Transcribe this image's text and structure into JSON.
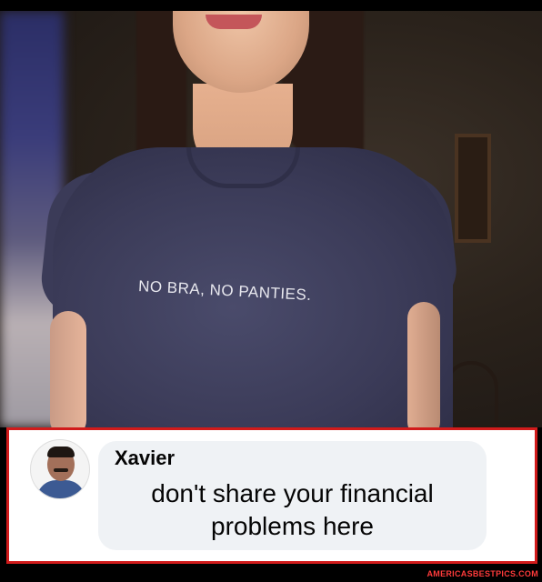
{
  "photo": {
    "shirt_text": "NO BRA, NO PANTIES."
  },
  "comment": {
    "author_name": "Xavier",
    "message_line1": "don't share your financial",
    "message_line2": "problems here",
    "border_color": "#d11b1b",
    "bubble_color": "#eff2f5"
  },
  "footer": {
    "watermark": "AMERICASBESTPICS.COM"
  }
}
